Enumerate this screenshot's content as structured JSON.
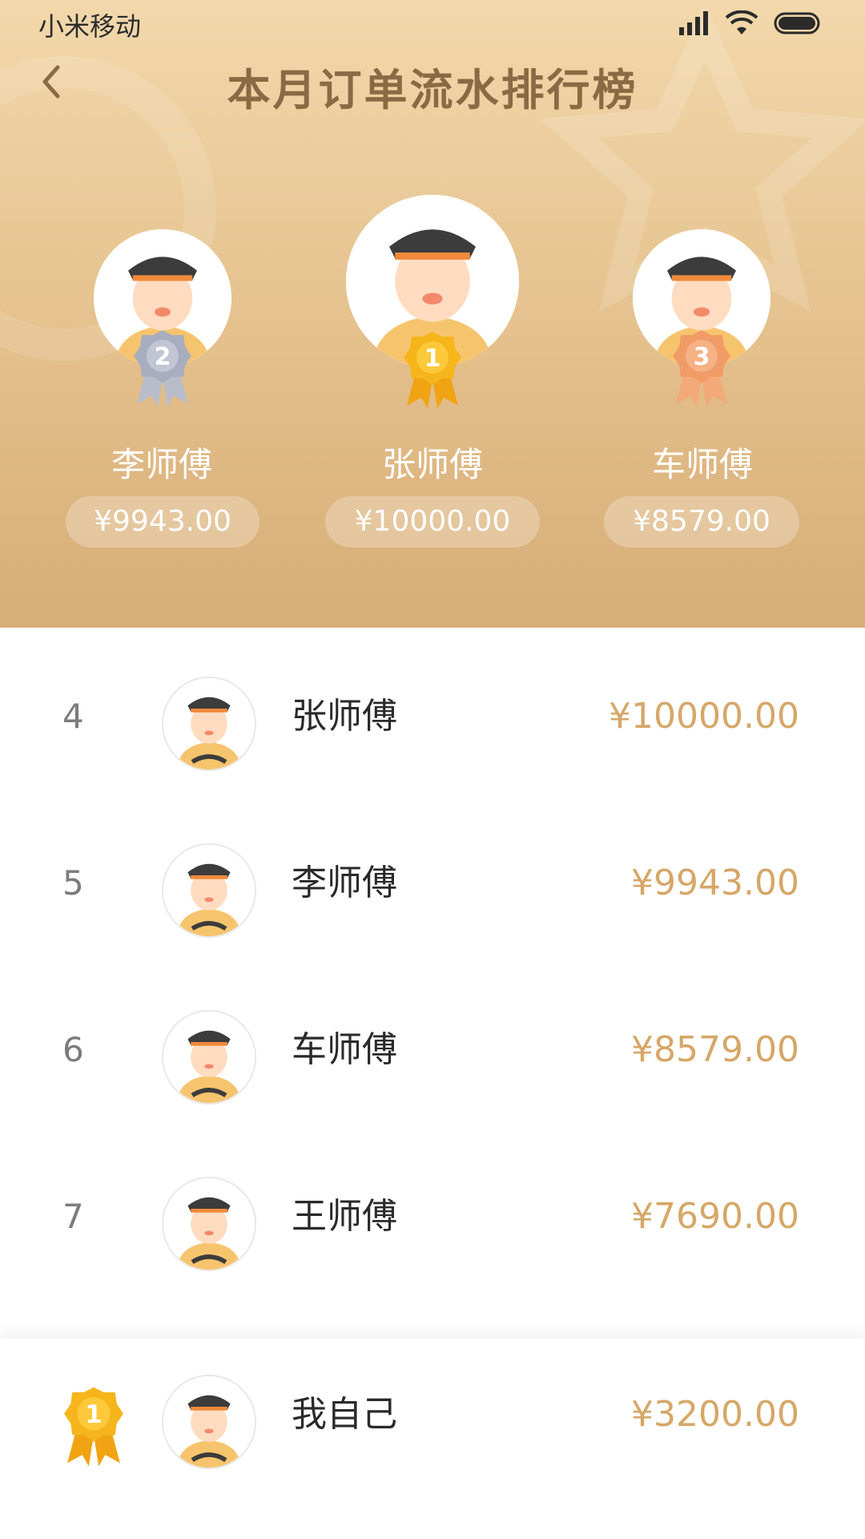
{
  "status_bar": {
    "carrier": "小米移动",
    "icons": [
      "signal-icon",
      "wifi-icon",
      "battery-icon"
    ]
  },
  "nav": {
    "back_icon": "chevron-left-icon",
    "title": "本月订单流水排行榜"
  },
  "podium": [
    {
      "rank": "2",
      "name": "李师傅",
      "amount": "¥9943.00",
      "medal_color": "#a8adbf"
    },
    {
      "rank": "1",
      "name": "张师傅",
      "amount": "¥10000.00",
      "medal_color": "#f6b51b"
    },
    {
      "rank": "3",
      "name": "车师傅",
      "amount": "¥8579.00",
      "medal_color": "#f19c66"
    }
  ],
  "list": [
    {
      "rank": "4",
      "name": "张师傅",
      "amount": "¥10000.00"
    },
    {
      "rank": "5",
      "name": "李师傅",
      "amount": "¥9943.00"
    },
    {
      "rank": "6",
      "name": "车师傅",
      "amount": "¥8579.00"
    },
    {
      "rank": "7",
      "name": "王师傅",
      "amount": "¥7690.00"
    }
  ],
  "mine": {
    "rank": "1",
    "name": "我自己",
    "amount": "¥3200.00"
  },
  "colors": {
    "accent": "#d6a768",
    "title": "#8a6a44",
    "header_top": "#f2d8ab",
    "header_bottom": "#d7ad78"
  }
}
